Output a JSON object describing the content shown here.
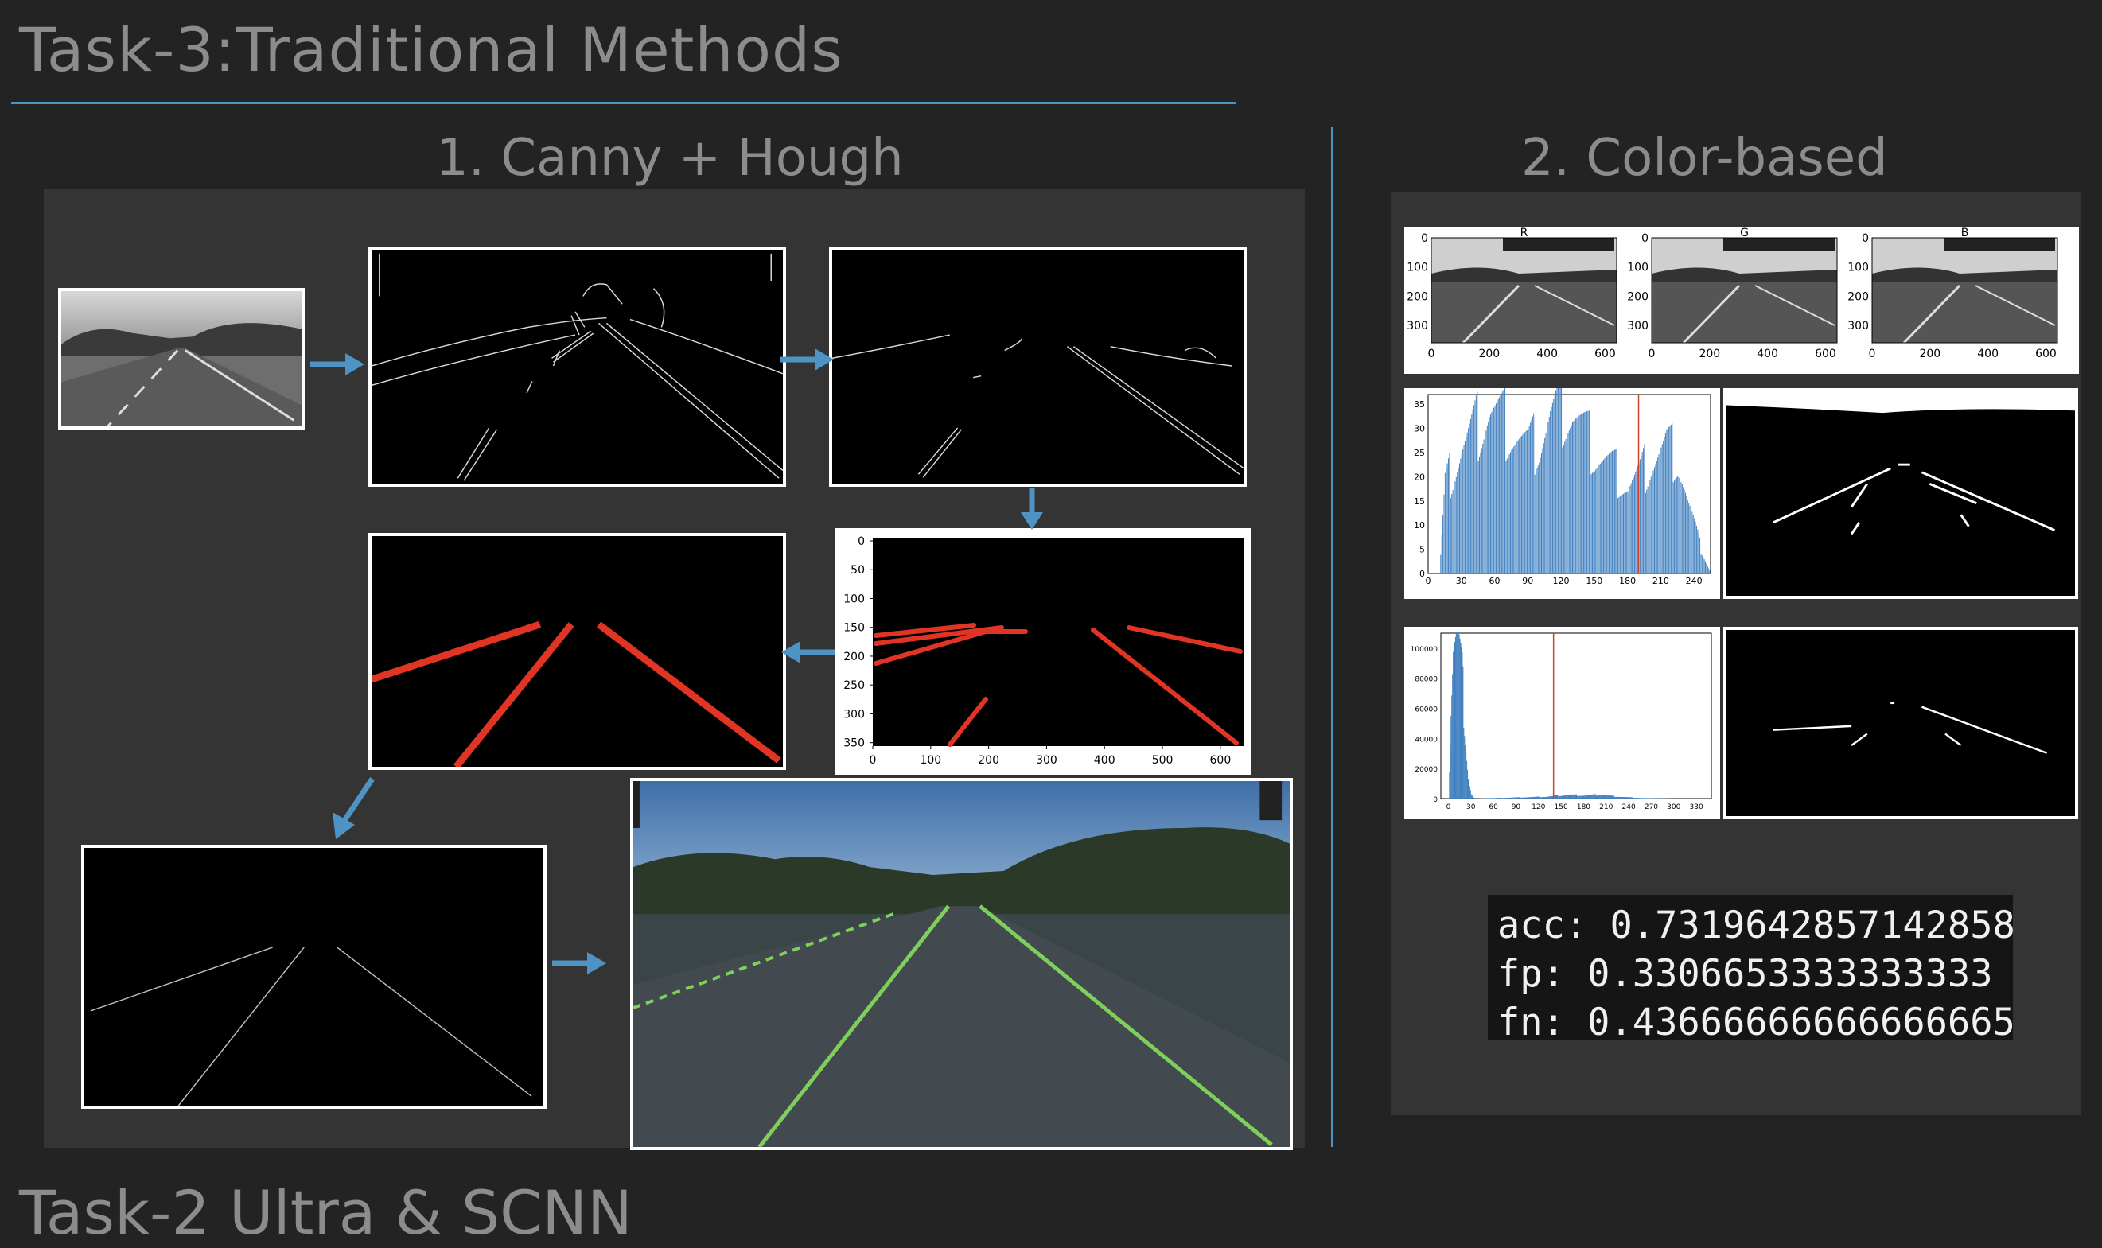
{
  "slide": {
    "title": "Task-3:Traditional Methods",
    "next_title_partial": "Task-2 Ultra & SCNN"
  },
  "sections": {
    "canny_hough": {
      "heading": "1. Canny + Hough"
    },
    "color_based": {
      "heading": "2. Color-based"
    }
  },
  "rgb_panels": {
    "labels": [
      "R",
      "G",
      "B"
    ],
    "y_ticks": [
      "0",
      "100",
      "200",
      "300"
    ],
    "x_ticks": [
      "0",
      "200",
      "400",
      "600"
    ]
  },
  "hough_plot": {
    "y_ticks": [
      "0",
      "50",
      "100",
      "150",
      "200",
      "250",
      "300",
      "350"
    ],
    "x_ticks": [
      "0",
      "100",
      "200",
      "300",
      "400",
      "500",
      "600"
    ]
  },
  "metrics": {
    "acc": "acc: 0.7319642857142858",
    "fp": "fp: 0.3306653333333333",
    "fn": "fn: 0.43666666666666665"
  },
  "colors": {
    "accent_blue": "#4f93c4",
    "lane_red": "#e03424",
    "lane_green": "#7fd05a",
    "hist_blue": "#3f7fbf",
    "threshold_red": "#d0402a"
  },
  "chart_data": [
    {
      "type": "bar",
      "name": "",
      "x_ticks": [
        "0",
        "30",
        "60",
        "90",
        "120",
        "150",
        "180",
        "210",
        "240"
      ],
      "y_ticks": [
        "0",
        "5",
        "10",
        "15",
        "20",
        "25",
        "30",
        "35"
      ],
      "xlim": [
        0,
        255
      ],
      "ylim": [
        0,
        37
      ],
      "threshold_x": 190,
      "profile": [
        [
          10,
          0
        ],
        [
          15,
          18
        ],
        [
          30,
          26
        ],
        [
          45,
          31
        ],
        [
          55,
          34
        ],
        [
          60,
          33
        ],
        [
          75,
          30
        ],
        [
          90,
          26
        ],
        [
          100,
          27
        ],
        [
          110,
          32
        ],
        [
          120,
          34
        ],
        [
          130,
          33
        ],
        [
          140,
          29
        ],
        [
          150,
          25
        ],
        [
          165,
          22
        ],
        [
          180,
          18
        ],
        [
          190,
          20
        ],
        [
          200,
          23
        ],
        [
          215,
          26
        ],
        [
          225,
          24
        ],
        [
          235,
          14
        ],
        [
          245,
          6
        ],
        [
          255,
          0
        ]
      ]
    },
    {
      "type": "bar",
      "name": "",
      "x_ticks": [
        "0",
        "30",
        "60",
        "90",
        "120",
        "150",
        "180",
        "210",
        "240",
        "270",
        "300",
        "330"
      ],
      "y_ticks": [
        "0",
        "20000",
        "40000",
        "60000",
        "80000",
        "100000"
      ],
      "xlim": [
        -10,
        350
      ],
      "ylim": [
        0,
        110000
      ],
      "threshold_x": 140,
      "profile": [
        [
          0,
          0
        ],
        [
          3,
          60000
        ],
        [
          6,
          100000
        ],
        [
          10,
          105000
        ],
        [
          14,
          96000
        ],
        [
          18,
          80000
        ],
        [
          22,
          45000
        ],
        [
          26,
          15000
        ],
        [
          30,
          3000
        ],
        [
          34,
          0
        ],
        [
          130,
          1200
        ],
        [
          160,
          2500
        ],
        [
          180,
          2000
        ],
        [
          200,
          2600
        ],
        [
          220,
          1500
        ],
        [
          240,
          800
        ],
        [
          260,
          300
        ],
        [
          300,
          0
        ]
      ]
    }
  ]
}
